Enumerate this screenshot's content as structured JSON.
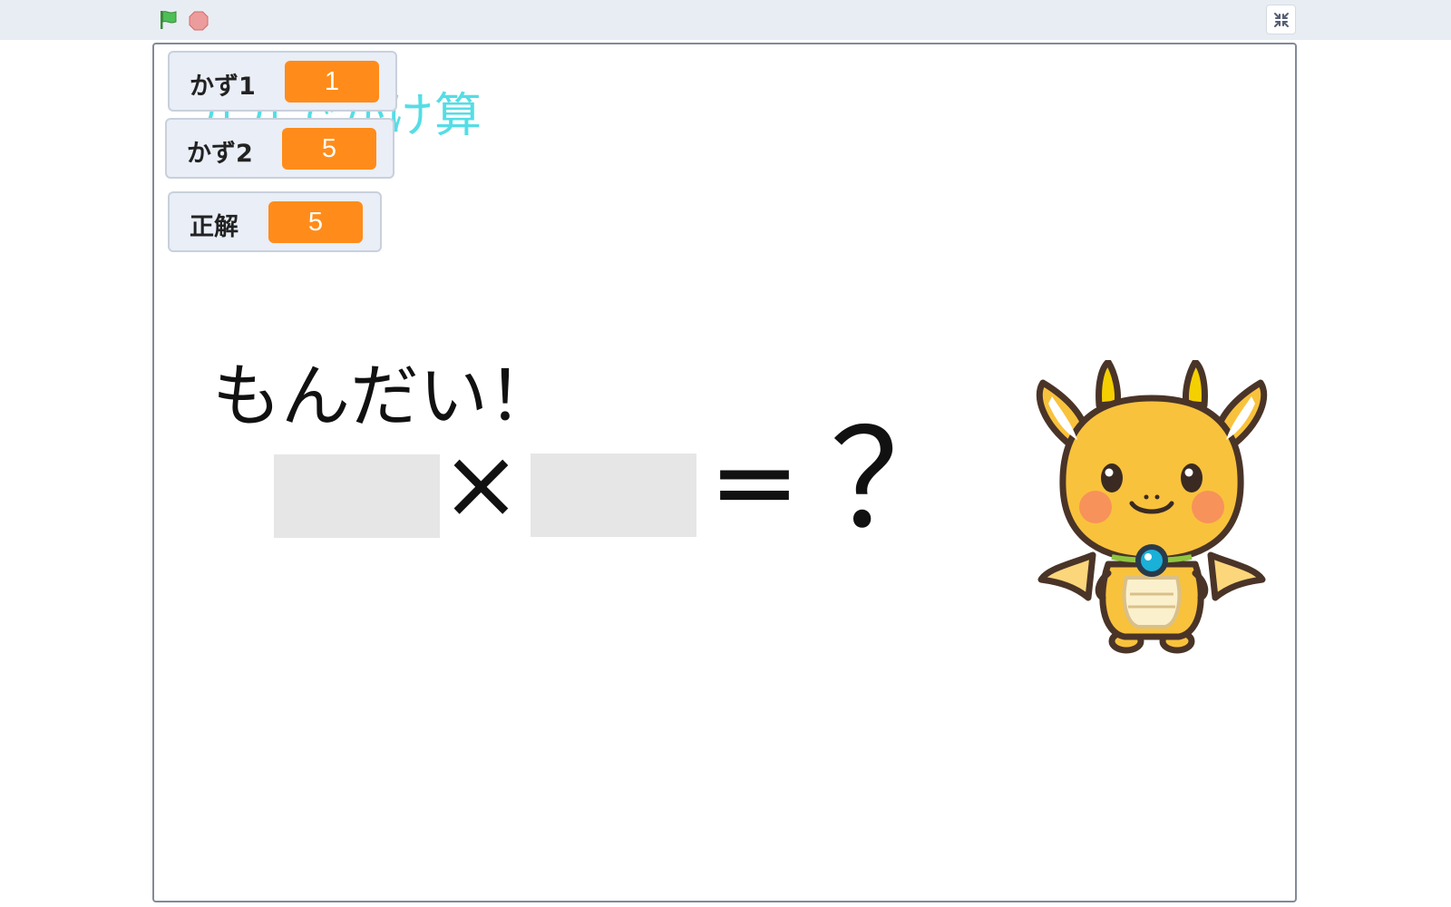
{
  "toolbar": {
    "green_flag_icon": "green-flag-icon",
    "stop_icon": "stop-sign-icon",
    "fullscreen_icon": "unfullscreen-icon"
  },
  "stage": {
    "title": "九九でかけ算"
  },
  "monitors": [
    {
      "label": "かず1",
      "value": "1"
    },
    {
      "label": "かず2",
      "value": "5"
    },
    {
      "label": "正解",
      "value": "5"
    }
  ],
  "problem": {
    "heading": "もんだい！",
    "times": "×",
    "equals": "＝",
    "unknown": "？"
  },
  "colors": {
    "monitor_value_bg": "#ff8c1a",
    "title": "#55dde5",
    "mascot_body": "#f9c23c"
  }
}
